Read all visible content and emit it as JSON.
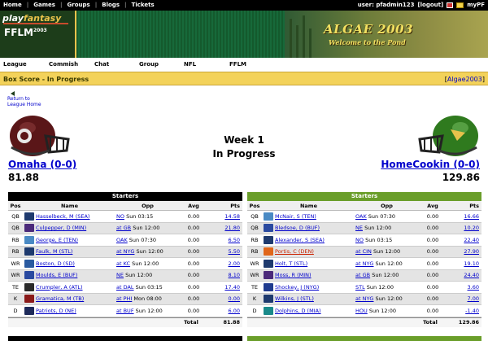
{
  "topbar": {
    "nav": [
      "Home",
      "Games",
      "Groups",
      "Blogs",
      "Tickets"
    ],
    "user_text": "user: pfadmin123",
    "logout": "[logout]",
    "my": "myPF"
  },
  "logo": {
    "play": "play",
    "fantasy": "fantasy",
    "ffl": "FFLM",
    "year": "2003"
  },
  "banner": {
    "title": "ALGAE 2003",
    "subtitle": "Welcome to the Pond"
  },
  "subnav": [
    "League",
    "Commish",
    "Chat",
    "Group",
    "NFL",
    "FFLM"
  ],
  "boxbar": {
    "title": "Box Score - In Progress",
    "league_link": "Algae2003"
  },
  "return_link": {
    "line1": "Return to",
    "line2": "League Home"
  },
  "matchup": {
    "week": "Week 1",
    "status": "In Progress",
    "left": {
      "team": "Omaha (0-0)",
      "score": "81.88"
    },
    "right": {
      "team": "HomeCookin (0-0)",
      "score": "129.86"
    }
  },
  "columns": {
    "pos": "Pos",
    "name": "Name",
    "opp": "Opp",
    "avg": "Avg",
    "pts": "Pts"
  },
  "left_table": {
    "caption": "Starters",
    "color": "#000000",
    "total_label": "Total",
    "total": "81.88",
    "rows": [
      {
        "pos": "QB",
        "logo": "SEA",
        "logo_color": "#1e3a6e",
        "name": "Hasselbeck, M (SEA)",
        "opp_link": "NO",
        "opp_time": "Sun 03:15",
        "avg": "0.00",
        "pts": "14.58",
        "injured": false
      },
      {
        "pos": "QB",
        "logo": "MIN",
        "logo_color": "#4b2a7a",
        "name": "Culpepper, D (MIN)",
        "opp_link": "at GB",
        "opp_time": "Sun 12:00",
        "avg": "0.00",
        "pts": "21.80",
        "injured": false
      },
      {
        "pos": "RB",
        "logo": "TEN",
        "logo_color": "#4a8ac4",
        "name": "George, E (TEN)",
        "opp_link": "OAK",
        "opp_time": "Sun 07:30",
        "avg": "0.00",
        "pts": "6.50",
        "injured": false
      },
      {
        "pos": "RB",
        "logo": "STL",
        "logo_color": "#1e3a6e",
        "name": "Faulk, M (STL)",
        "opp_link": "at NYG",
        "opp_time": "Sun 12:00",
        "avg": "0.00",
        "pts": "5.50",
        "injured": false
      },
      {
        "pos": "WR",
        "logo": "SD",
        "logo_color": "#2a5aa0",
        "name": "Boston, D (SD)",
        "opp_link": "at KC",
        "opp_time": "Sun 12:00",
        "avg": "0.00",
        "pts": "2.00",
        "injured": false
      },
      {
        "pos": "WR",
        "logo": "BUF",
        "logo_color": "#2a4aa0",
        "name": "Moulds, E (BUF)",
        "opp_link": "NE",
        "opp_time": "Sun 12:00",
        "avg": "0.00",
        "pts": "8.10",
        "injured": false
      },
      {
        "pos": "TE",
        "logo": "ATL",
        "logo_color": "#2a2a2a",
        "name": "Crumpler, A (ATL)",
        "opp_link": "at DAL",
        "opp_time": "Sun 03:15",
        "avg": "0.00",
        "pts": "17.40",
        "injured": false
      },
      {
        "pos": "K",
        "logo": "TB",
        "logo_color": "#8a1a1a",
        "name": "Gramatica, M (TB)",
        "opp_link": "at PHI",
        "opp_time": "Mon 08:00",
        "avg": "0.00",
        "pts": "0.00",
        "injured": false
      },
      {
        "pos": "D",
        "logo": "NE",
        "logo_color": "#1e2a5a",
        "name": "Patriots, D (NE)",
        "opp_link": "at BUF",
        "opp_time": "Sun 12:00",
        "avg": "0.00",
        "pts": "6.00",
        "injured": false
      }
    ]
  },
  "right_table": {
    "caption": "Starters",
    "color": "#6a9e2a",
    "total_label": "Total",
    "total": "129.86",
    "rows": [
      {
        "pos": "QB",
        "logo": "TEN",
        "logo_color": "#4a8ac4",
        "name": "McNair, S (TEN)",
        "opp_link": "OAK",
        "opp_time": "Sun 07:30",
        "avg": "0.00",
        "pts": "16.66",
        "injured": false
      },
      {
        "pos": "QB",
        "logo": "BUF",
        "logo_color": "#2a4aa0",
        "name": "Bledsoe, D (BUF)",
        "opp_link": "NE",
        "opp_time": "Sun 12:00",
        "avg": "0.00",
        "pts": "10.20",
        "injured": false
      },
      {
        "pos": "RB",
        "logo": "SEA",
        "logo_color": "#1e3a6e",
        "name": "Alexander, S (SEA)",
        "opp_link": "NO",
        "opp_time": "Sun 03:15",
        "avg": "0.00",
        "pts": "22.40",
        "injured": false
      },
      {
        "pos": "RB",
        "logo": "DEN",
        "logo_color": "#e0661a",
        "name": "Portis, C (DEN)",
        "opp_link": "at CIN",
        "opp_time": "Sun 12:00",
        "avg": "0.00",
        "pts": "27.90",
        "injured": true
      },
      {
        "pos": "WR",
        "logo": "STL",
        "logo_color": "#1e3a6e",
        "name": "Holt, T (STL)",
        "opp_link": "at NYG",
        "opp_time": "Sun 12:00",
        "avg": "0.00",
        "pts": "19.10",
        "injured": false
      },
      {
        "pos": "WR",
        "logo": "MIN",
        "logo_color": "#4b2a7a",
        "name": "Moss, R (MIN)",
        "opp_link": "at GB",
        "opp_time": "Sun 12:00",
        "avg": "0.00",
        "pts": "24.40",
        "injured": false
      },
      {
        "pos": "TE",
        "logo": "NYG",
        "logo_color": "#1e3a8e",
        "name": "Shockey, J (NYG)",
        "opp_link": "STL",
        "opp_time": "Sun 12:00",
        "avg": "0.00",
        "pts": "3.60",
        "injured": false
      },
      {
        "pos": "K",
        "logo": "STL",
        "logo_color": "#1e3a6e",
        "name": "Wilkins, J (STL)",
        "opp_link": "at NYG",
        "opp_time": "Sun 12:00",
        "avg": "0.00",
        "pts": "7.00",
        "injured": false
      },
      {
        "pos": "D",
        "logo": "MIA",
        "logo_color": "#1a8a8a",
        "name": "Dolphins, D (MIA)",
        "opp_link": "HOU",
        "opp_time": "Sun 12:00",
        "avg": "0.00",
        "pts": "-1.40",
        "injured": false
      }
    ]
  }
}
